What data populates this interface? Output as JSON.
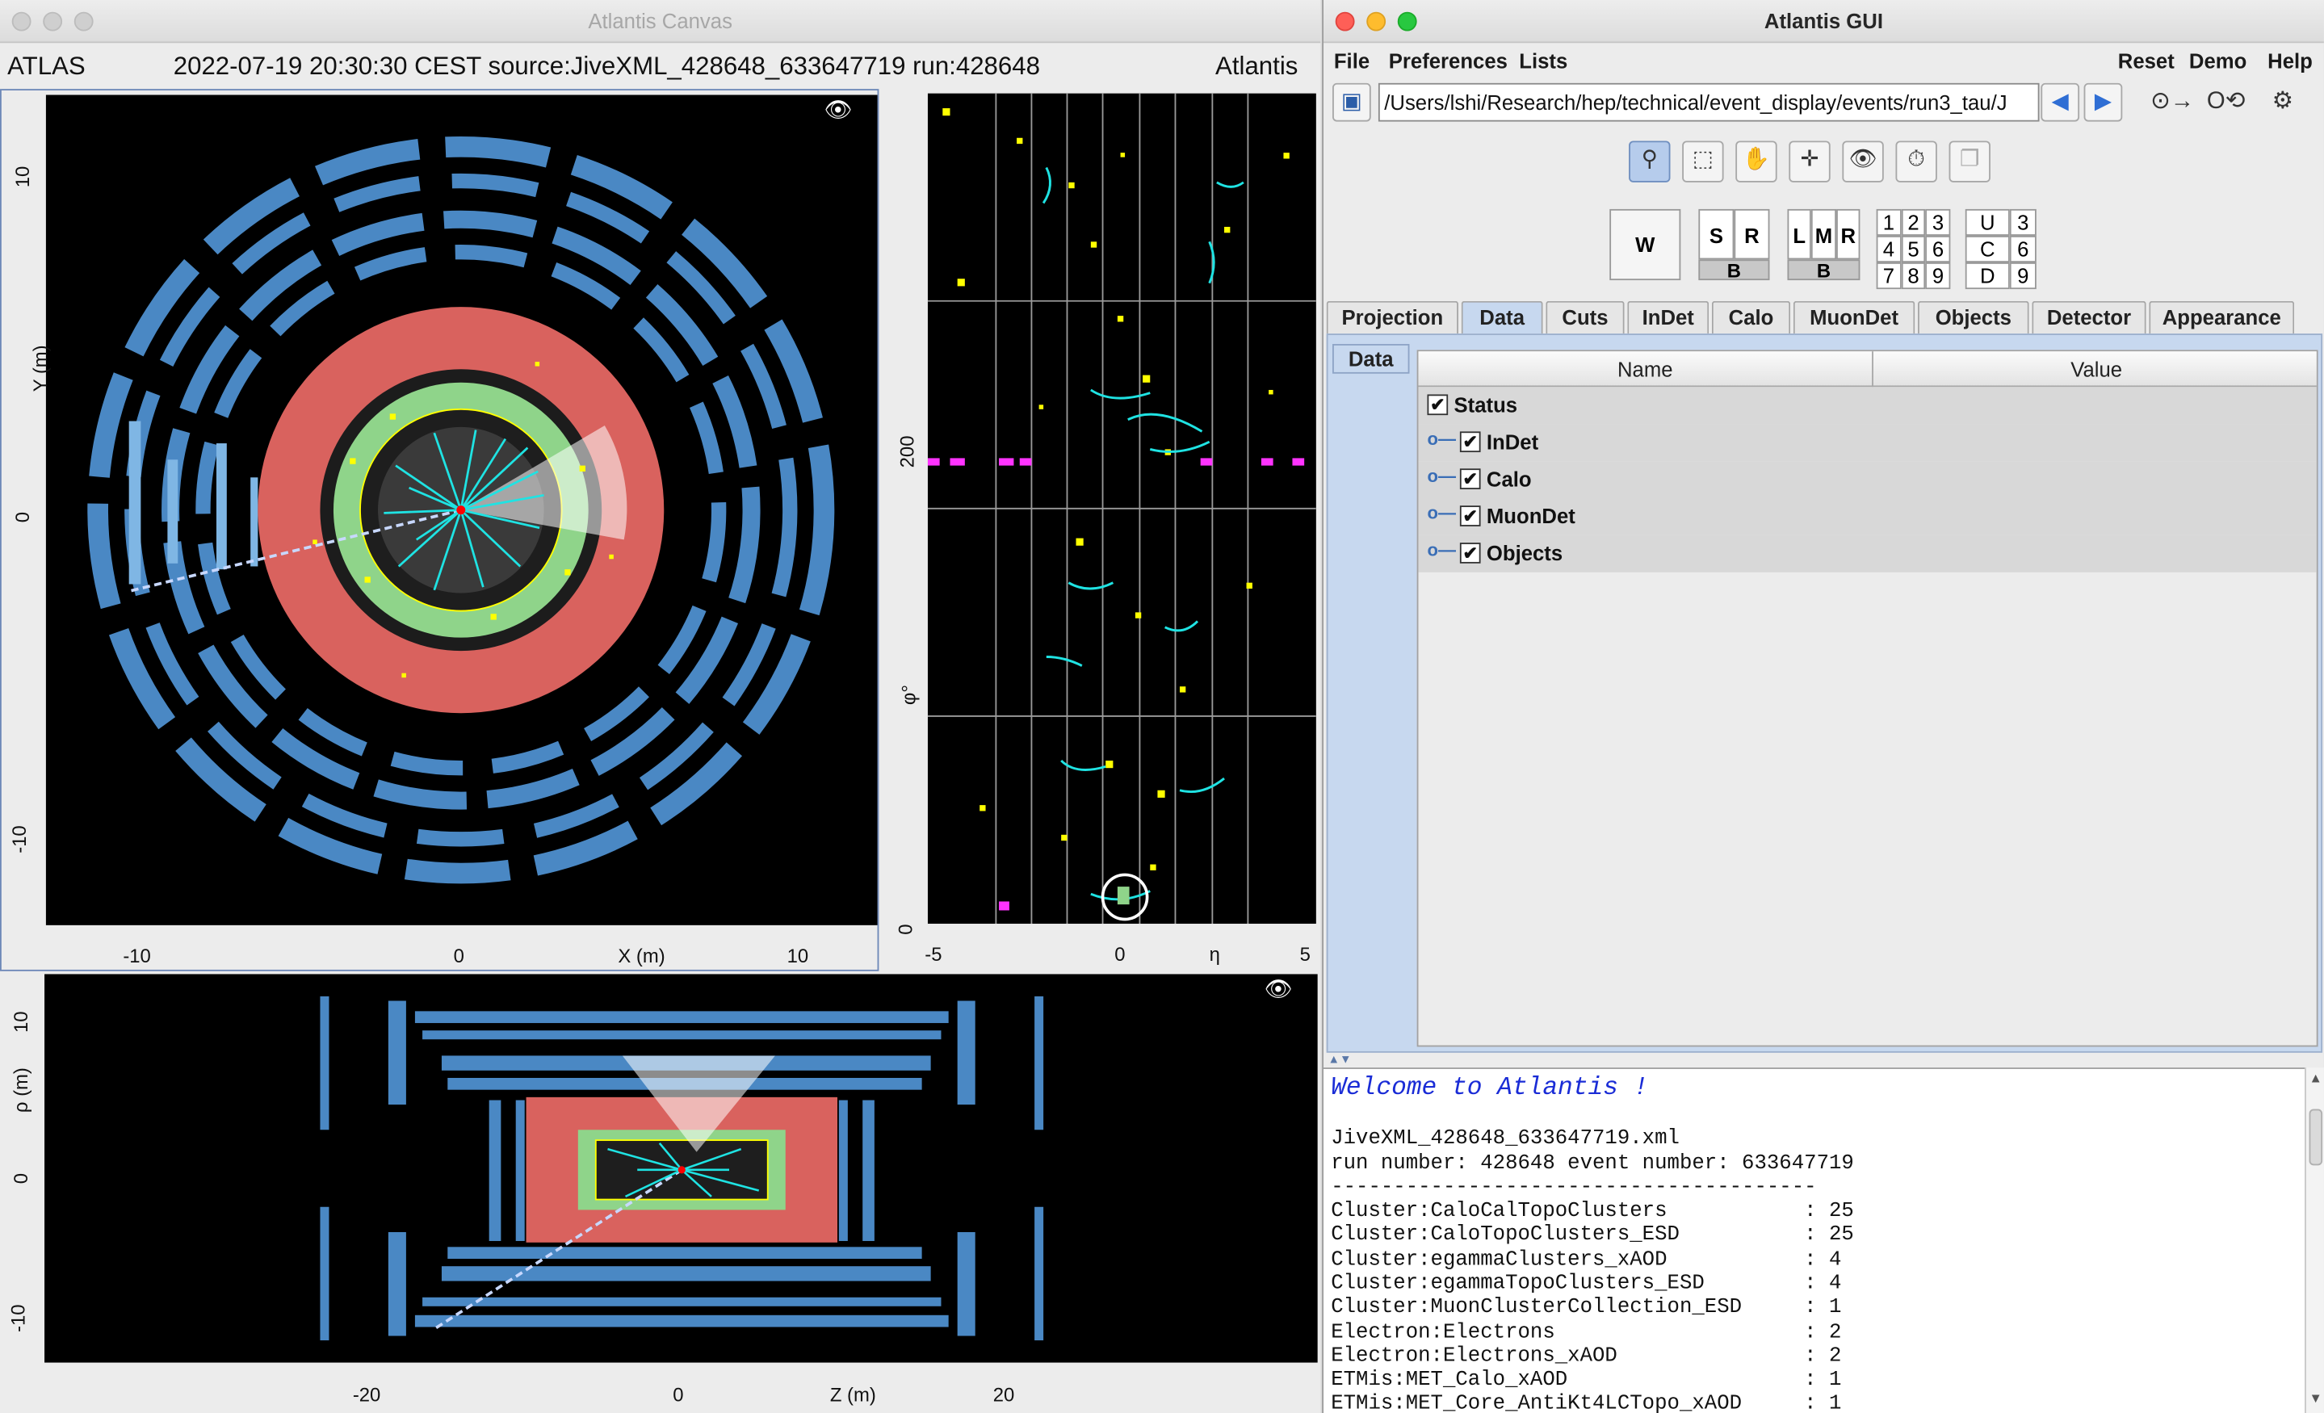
{
  "canvas_window": {
    "title": "Atlantis Canvas",
    "info_left": "ATLAS",
    "info_center": "2022-07-19 20:30:30 CEST source:JiveXML_428648_633647719 run:428648",
    "info_right": "Atlantis"
  },
  "xy_view": {
    "y_axis_label": "Y (m)",
    "x_axis_label": "X (m)",
    "x_ticks": [
      "-10",
      "0",
      "10"
    ],
    "y_ticks": [
      "10",
      "0",
      "-10"
    ]
  },
  "phi_eta_view": {
    "y_axis_label": "φ°",
    "x_axis_label": "η",
    "x_ticks": [
      "-5",
      "0",
      "5"
    ],
    "y_ticks": [
      "200",
      "0"
    ]
  },
  "rho_z_view": {
    "y_axis_label": "ρ (m)",
    "x_axis_label": "Z (m)",
    "x_ticks": [
      "-20",
      "0",
      "20"
    ],
    "y_ticks": [
      "10",
      "0",
      "-10"
    ]
  },
  "gui_window": {
    "title": "Atlantis GUI",
    "menu_left": [
      "File",
      "Preferences",
      "Lists"
    ],
    "menu_right": [
      "Reset",
      "Demo",
      "Help"
    ],
    "path": "/Users/lshi/Research/hep/technical/event_display/events/run3_tau/J"
  },
  "window_selector": {
    "w": "W",
    "sr": [
      "S",
      "R",
      "B"
    ],
    "lmr": [
      "L",
      "M",
      "R",
      "B"
    ],
    "numbers": [
      "1",
      "2",
      "3",
      "4",
      "5",
      "6",
      "7",
      "8",
      "9"
    ],
    "ucd": [
      "U",
      "3",
      "C",
      "6",
      "D",
      "9"
    ]
  },
  "tabs": [
    "Projection",
    "Data",
    "Cuts",
    "InDet",
    "Calo",
    "MuonDet",
    "Objects",
    "Detector",
    "Appearance"
  ],
  "active_tab": "Data",
  "side_tab": "Data",
  "table": {
    "col_name": "Name",
    "col_value": "Value",
    "rows": [
      "Status",
      "InDet",
      "Calo",
      "MuonDet",
      "Objects"
    ]
  },
  "console": {
    "welcome": "Welcome to Atlantis !",
    "file": "JiveXML_428648_633647719.xml",
    "run_line": "run number: 428648 event number: 633647719",
    "separator": "---------------------------------------",
    "entries": [
      "Cluster:CaloCalTopoClusters           : 25",
      "Cluster:CaloTopoClusters_ESD          : 25",
      "Cluster:egammaClusters_xAOD           : 4",
      "Cluster:egammaTopoClusters_ESD        : 4",
      "Cluster:MuonClusterCollection_ESD     : 1",
      "Electron:Electrons                    : 2",
      "Electron:Electrons_xAOD               : 2",
      "ETMis:MET_Calo_xAOD                   : 1",
      "ETMis:MET_Core_AntiKt4LCTopo_xAOD     : 1"
    ]
  },
  "colors": {
    "muon": "#4a88c4",
    "calo_had": "#d9625e",
    "calo_em": "#8fd48a",
    "tracks": "#1fe3e3",
    "hits": "#ffff00",
    "magenta": "#ff33ff",
    "tab_active": "#c7d8ef"
  },
  "icons": [
    "save-icon",
    "back-arrow-icon",
    "forward-arrow-icon",
    "zoom-icon",
    "rubberband-icon",
    "hand-icon",
    "crosshair-icon",
    "fisheye-icon",
    "clock-icon",
    "window-icon"
  ]
}
